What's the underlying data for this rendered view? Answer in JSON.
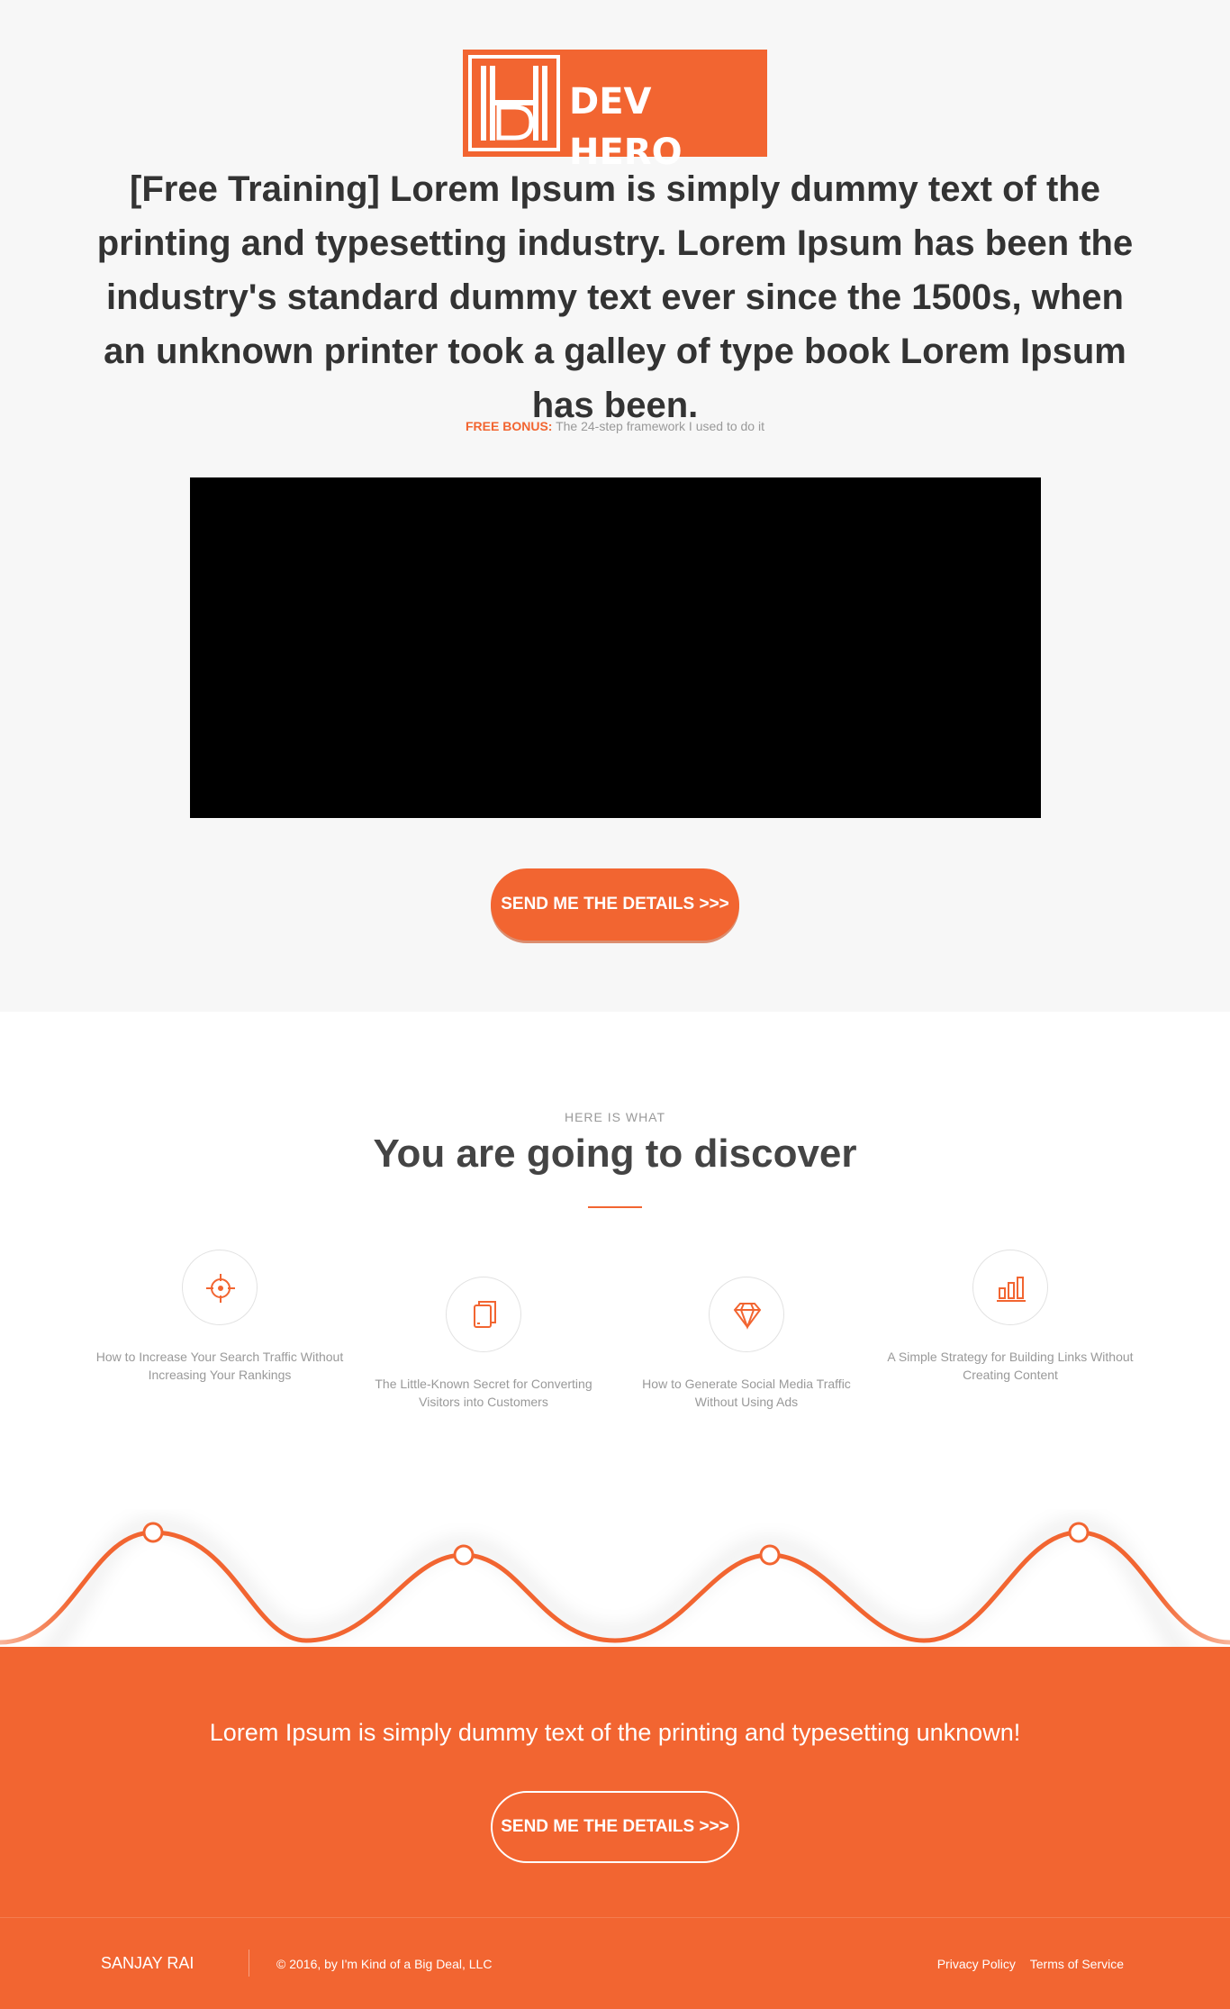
{
  "brand": {
    "name": "DEV HERO",
    "accent": "#f26531"
  },
  "hero": {
    "headline": "[Free Training] Lorem Ipsum is simply dummy text of the printing and typesetting industry. Lorem Ipsum has been the industry's standard dummy text ever since the 1500s, when an unknown printer took a galley of type book Lorem Ipsum has been.",
    "bonus_label": "FREE BONUS:",
    "bonus_text": "The 24-step framework I used to do it",
    "cta_label": "SEND ME THE DETAILS >>>"
  },
  "discover": {
    "eyebrow": "HERE IS WHAT",
    "title": "You are going to discover",
    "features": [
      {
        "icon": "crosshair-icon",
        "text": "How to Increase Your Search Traffic Without Increasing Your Rankings"
      },
      {
        "icon": "tablet-icon",
        "text": "The Little-Known Secret for Converting Visitors into Customers"
      },
      {
        "icon": "diamond-icon",
        "text": "How to Generate Social Media Traffic Without Using Ads"
      },
      {
        "icon": "bar-chart-icon",
        "text": "A Simple Strategy for Building Links Without Creating Content"
      }
    ]
  },
  "band": {
    "text": "Lorem Ipsum is simply dummy text of the printing and typesetting unknown!",
    "cta_label": "SEND ME THE DETAILS >>>"
  },
  "footer": {
    "brand": "SANJAY RAI",
    "copyright": "© 2016, by I'm Kind of a Big Deal, LLC",
    "links": [
      "Privacy Policy",
      "Terms of Service"
    ]
  }
}
